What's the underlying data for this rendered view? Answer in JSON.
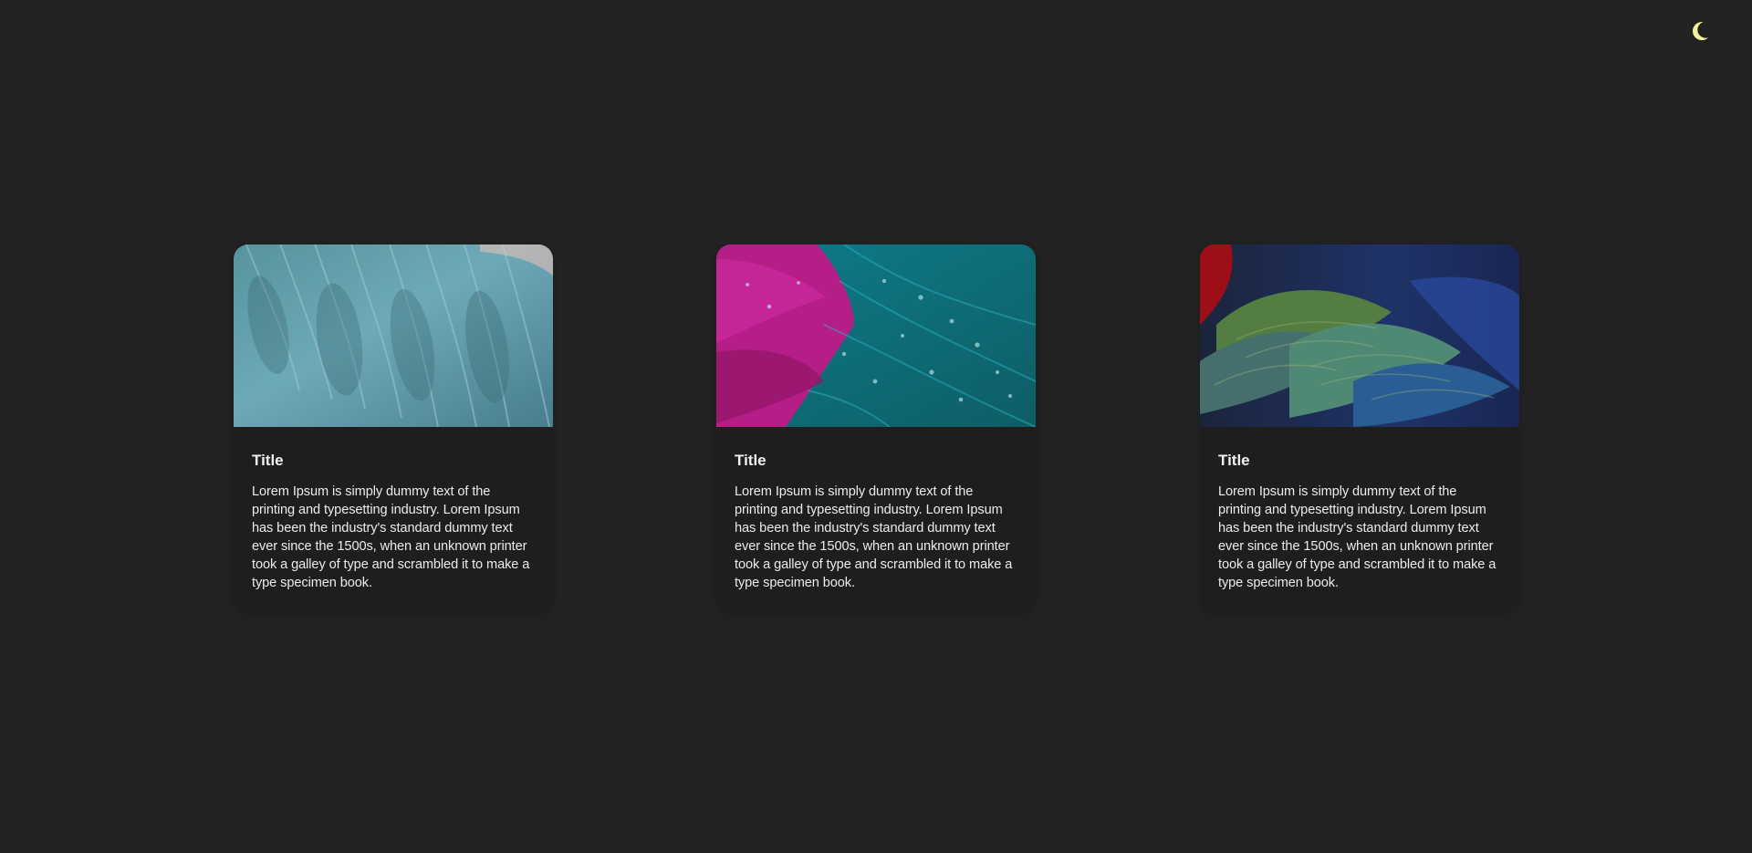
{
  "header": {
    "theme_toggle_icon": "moon-icon",
    "accent_color": "#f3f29a"
  },
  "cards": [
    {
      "title": "Title",
      "text": "Lorem Ipsum is simply dummy text of the printing and typesetting industry. Lorem Ipsum has been the industry's standard dummy text ever since the 1500s, when an unknown printer took a galley of type and scrambled it to make a type specimen book.",
      "image_theme": "blue-teal-feathers"
    },
    {
      "title": "Title",
      "text": "Lorem Ipsum is simply dummy text of the printing and typesetting industry. Lorem Ipsum has been the industry's standard dummy text ever since the 1500s, when an unknown printer took a galley of type and scrambled it to make a type specimen book.",
      "image_theme": "magenta-cyan-feathers"
    },
    {
      "title": "Title",
      "text": "Lorem Ipsum is simply dummy text of the printing and typesetting industry. Lorem Ipsum has been the industry's standard dummy text ever since the 1500s, when an unknown printer took a galley of type and scrambled it to make a type specimen book.",
      "image_theme": "green-blue-red-feathers"
    }
  ],
  "colors": {
    "background": "#222222",
    "card_background": "#1e1e1e",
    "text": "#ececec"
  }
}
